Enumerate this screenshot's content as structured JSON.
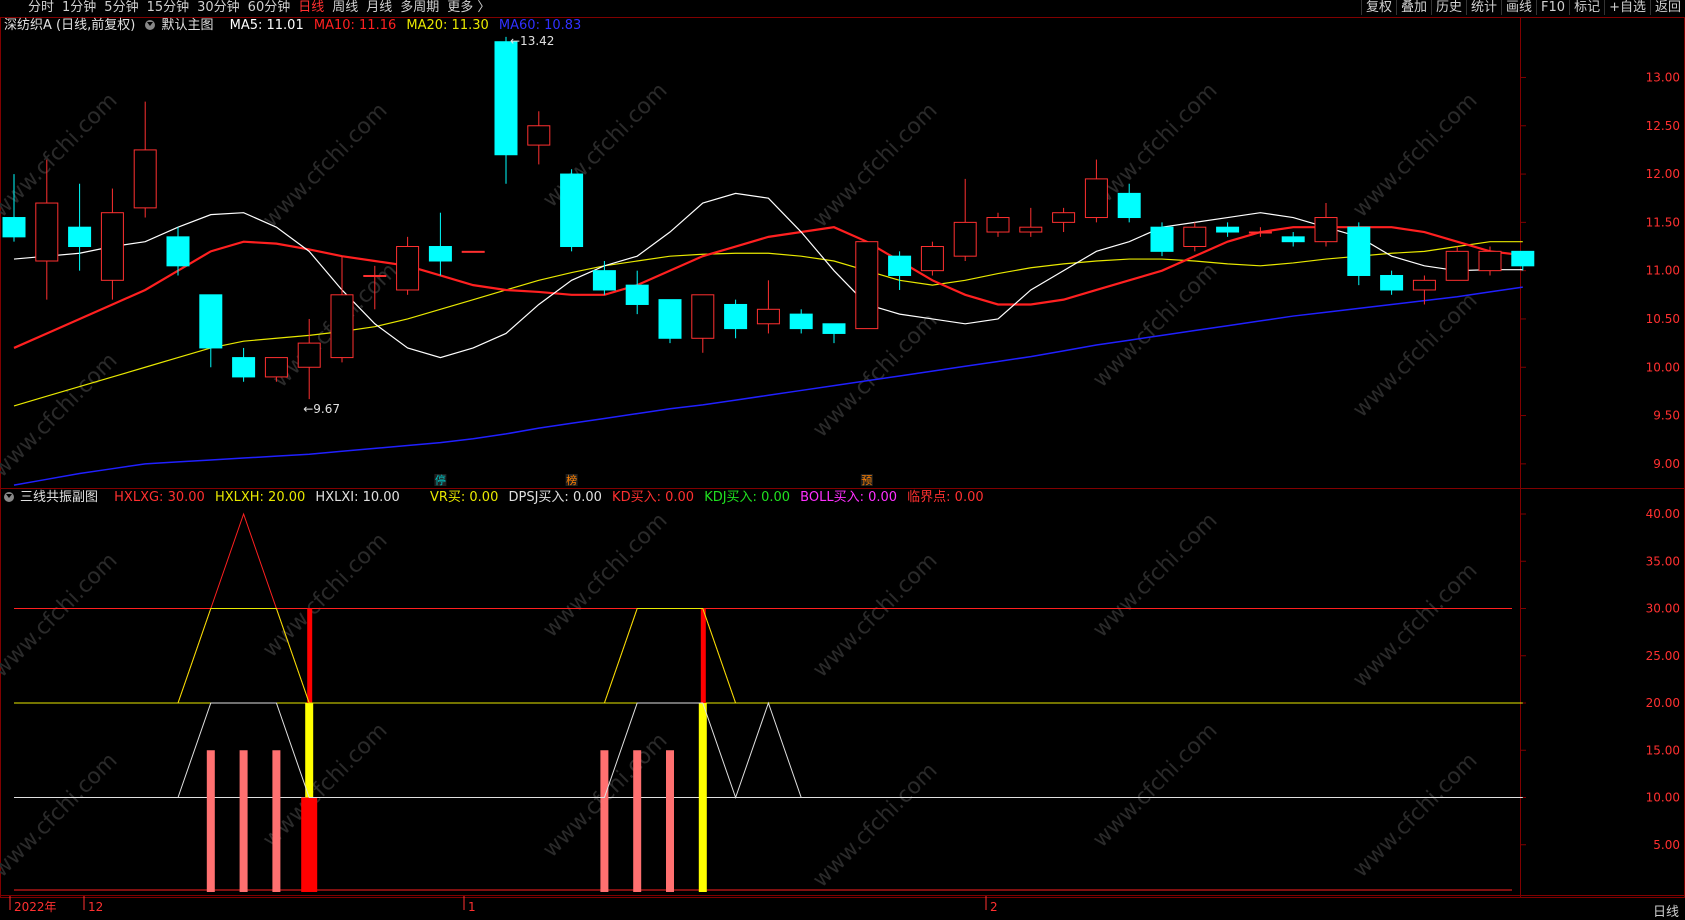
{
  "toolbar": {
    "periods": [
      "分时",
      "1分钟",
      "5分钟",
      "15分钟",
      "30分钟",
      "60分钟",
      "日线",
      "周线",
      "月线",
      "多周期",
      "更多 〉"
    ],
    "active_period": "日线",
    "right_buttons": [
      "复权",
      "叠加",
      "历史",
      "统计",
      "画线",
      "F10",
      "标记",
      "+自选",
      "返回"
    ]
  },
  "main_legend": {
    "stock": "深纺织A (日线,前复权)",
    "indicator": "默认主图",
    "ma5": "MA5: 11.01",
    "ma10": "MA10: 11.16",
    "ma20": "MA20: 11.30",
    "ma60": "MA60: 10.83"
  },
  "sub_legend": {
    "name": "三线共振副图",
    "hxlxg": "HXLXG: 30.00",
    "hxlxh": "HXLXH: 20.00",
    "hxlxi": "HXLXI: 10.00",
    "vr": "VR买: 0.00",
    "dpsj": "DPSJ买入: 0.00",
    "kd": "KD买入: 0.00",
    "kdj": "KDJ买入: 0.00",
    "boll": "BOLL买入: 0.00",
    "lj": "临界点: 0.00"
  },
  "colors": {
    "up": "#ff3030",
    "down": "#00ffff",
    "ma5": "#ffffff",
    "ma10": "#ff2020",
    "ma20": "#e8e800",
    "ma60": "#2020ff",
    "grid": "#800000",
    "axis_text": "#ff3030"
  },
  "markers": {
    "high": "13.42",
    "low": "9.67",
    "tags": [
      "停",
      "榜",
      "预"
    ]
  },
  "price_axis": [
    "13.00",
    "12.50",
    "12.00",
    "11.50",
    "11.00",
    "10.50",
    "10.00",
    "9.50",
    "9.00"
  ],
  "sub_axis": [
    "40.00",
    "35.00",
    "30.00",
    "25.00",
    "20.00",
    "15.00",
    "10.00",
    "5.00"
  ],
  "x_labels": [
    "2022年",
    "12",
    "1",
    "2"
  ],
  "bottom_right": "日线",
  "watermark": "www.cfchi.com",
  "chart_data": {
    "type": "candlestick",
    "price_range": [
      8.75,
      13.45
    ],
    "candles": [
      {
        "o": 11.55,
        "c": 11.35,
        "h": 12.0,
        "l": 11.3
      },
      {
        "o": 11.1,
        "c": 11.7,
        "h": 12.15,
        "l": 10.7
      },
      {
        "o": 11.45,
        "c": 11.25,
        "h": 11.9,
        "l": 11.0
      },
      {
        "o": 10.9,
        "c": 11.6,
        "h": 11.85,
        "l": 10.7
      },
      {
        "o": 11.65,
        "c": 12.25,
        "h": 12.75,
        "l": 11.55
      },
      {
        "o": 11.35,
        "c": 11.05,
        "h": 11.45,
        "l": 10.95
      },
      {
        "o": 10.75,
        "c": 10.2,
        "h": 10.65,
        "l": 10.0
      },
      {
        "o": 10.1,
        "c": 9.9,
        "h": 10.2,
        "l": 9.85
      },
      {
        "o": 9.9,
        "c": 10.1,
        "h": 10.1,
        "l": 9.85
      },
      {
        "o": 10.0,
        "c": 10.25,
        "h": 10.5,
        "l": 9.67
      },
      {
        "o": 10.1,
        "c": 10.75,
        "h": 11.15,
        "l": 10.05
      },
      {
        "o": 10.95,
        "c": 10.95,
        "h": 11.05,
        "l": 10.6
      },
      {
        "o": 10.8,
        "c": 11.25,
        "h": 11.35,
        "l": 10.75
      },
      {
        "o": 11.25,
        "c": 11.1,
        "h": 11.6,
        "l": 10.95
      },
      {
        "o": 11.2,
        "c": 11.2,
        "h": 11.2,
        "l": 11.2
      },
      {
        "o": 13.37,
        "c": 12.2,
        "h": 13.42,
        "l": 11.9
      },
      {
        "o": 12.3,
        "c": 12.5,
        "h": 12.65,
        "l": 12.1
      },
      {
        "o": 12.0,
        "c": 11.25,
        "h": 12.05,
        "l": 11.2
      },
      {
        "o": 11.0,
        "c": 10.8,
        "h": 11.1,
        "l": 10.75
      },
      {
        "o": 10.85,
        "c": 10.65,
        "h": 11.0,
        "l": 10.55
      },
      {
        "o": 10.7,
        "c": 10.3,
        "h": 10.7,
        "l": 10.25
      },
      {
        "o": 10.3,
        "c": 10.75,
        "h": 10.75,
        "l": 10.15
      },
      {
        "o": 10.65,
        "c": 10.4,
        "h": 10.7,
        "l": 10.3
      },
      {
        "o": 10.45,
        "c": 10.6,
        "h": 10.9,
        "l": 10.35
      },
      {
        "o": 10.55,
        "c": 10.4,
        "h": 10.6,
        "l": 10.35
      },
      {
        "o": 10.45,
        "c": 10.35,
        "h": 10.45,
        "l": 10.25
      },
      {
        "o": 10.4,
        "c": 11.3,
        "h": 11.3,
        "l": 10.4
      },
      {
        "o": 11.15,
        "c": 10.95,
        "h": 11.2,
        "l": 10.8
      },
      {
        "o": 11.0,
        "c": 11.25,
        "h": 11.3,
        "l": 10.95
      },
      {
        "o": 11.15,
        "c": 11.5,
        "h": 11.95,
        "l": 11.1
      },
      {
        "o": 11.4,
        "c": 11.55,
        "h": 11.6,
        "l": 11.35
      },
      {
        "o": 11.4,
        "c": 11.45,
        "h": 11.65,
        "l": 11.35
      },
      {
        "o": 11.5,
        "c": 11.6,
        "h": 11.65,
        "l": 11.4
      },
      {
        "o": 11.55,
        "c": 11.95,
        "h": 12.15,
        "l": 11.5
      },
      {
        "o": 11.8,
        "c": 11.55,
        "h": 11.9,
        "l": 11.5
      },
      {
        "o": 11.45,
        "c": 11.2,
        "h": 11.5,
        "l": 11.15
      },
      {
        "o": 11.25,
        "c": 11.45,
        "h": 11.5,
        "l": 11.2
      },
      {
        "o": 11.45,
        "c": 11.4,
        "h": 11.5,
        "l": 11.35
      },
      {
        "o": 11.4,
        "c": 11.4,
        "h": 11.45,
        "l": 11.35
      },
      {
        "o": 11.35,
        "c": 11.3,
        "h": 11.4,
        "l": 11.25
      },
      {
        "o": 11.3,
        "c": 11.55,
        "h": 11.7,
        "l": 11.25
      },
      {
        "o": 11.45,
        "c": 10.95,
        "h": 11.5,
        "l": 10.85
      },
      {
        "o": 10.95,
        "c": 10.8,
        "h": 11.0,
        "l": 10.75
      },
      {
        "o": 10.8,
        "c": 10.9,
        "h": 10.95,
        "l": 10.65
      },
      {
        "o": 10.9,
        "c": 11.2,
        "h": 11.25,
        "l": 10.9
      },
      {
        "o": 11.0,
        "c": 11.2,
        "h": 11.25,
        "l": 10.95
      },
      {
        "o": 11.2,
        "c": 11.05,
        "h": 11.2,
        "l": 11.0
      }
    ],
    "ma5": [
      11.12,
      11.15,
      11.18,
      11.25,
      11.3,
      11.45,
      11.58,
      11.6,
      11.45,
      11.2,
      10.8,
      10.45,
      10.2,
      10.1,
      10.2,
      10.35,
      10.65,
      10.9,
      11.05,
      11.15,
      11.4,
      11.7,
      11.8,
      11.75,
      11.4,
      11.0,
      10.65,
      10.55,
      10.5,
      10.45,
      10.5,
      10.8,
      11.0,
      11.2,
      11.3,
      11.45,
      11.5,
      11.55,
      11.6,
      11.55,
      11.45,
      11.35,
      11.15,
      11.05,
      11.0,
      11.01,
      11.01
    ],
    "ma10": [
      10.2,
      10.35,
      10.5,
      10.65,
      10.8,
      11.0,
      11.2,
      11.3,
      11.28,
      11.22,
      11.15,
      11.1,
      11.05,
      10.95,
      10.85,
      10.8,
      10.78,
      10.75,
      10.75,
      10.85,
      11.0,
      11.15,
      11.25,
      11.35,
      11.4,
      11.45,
      11.3,
      11.1,
      10.9,
      10.75,
      10.65,
      10.65,
      10.7,
      10.8,
      10.9,
      11.0,
      11.15,
      11.3,
      11.4,
      11.45,
      11.45,
      11.45,
      11.45,
      11.4,
      11.3,
      11.2,
      11.16
    ],
    "ma20": [
      9.6,
      9.7,
      9.8,
      9.9,
      10.0,
      10.1,
      10.2,
      10.27,
      10.3,
      10.33,
      10.37,
      10.42,
      10.5,
      10.6,
      10.7,
      10.8,
      10.9,
      10.98,
      11.05,
      11.1,
      11.15,
      11.17,
      11.18,
      11.18,
      11.15,
      11.1,
      11.0,
      10.9,
      10.85,
      10.9,
      10.97,
      11.03,
      11.07,
      11.1,
      11.12,
      11.12,
      11.1,
      11.07,
      11.05,
      11.08,
      11.12,
      11.15,
      11.18,
      11.2,
      11.25,
      11.3,
      11.3
    ],
    "ma60": [
      8.78,
      8.84,
      8.9,
      8.95,
      9.0,
      9.02,
      9.04,
      9.06,
      9.08,
      9.1,
      9.13,
      9.16,
      9.19,
      9.22,
      9.26,
      9.31,
      9.37,
      9.42,
      9.47,
      9.52,
      9.57,
      9.61,
      9.66,
      9.71,
      9.76,
      9.81,
      9.86,
      9.91,
      9.96,
      10.01,
      10.06,
      10.11,
      10.17,
      10.23,
      10.28,
      10.33,
      10.38,
      10.43,
      10.48,
      10.53,
      10.57,
      10.61,
      10.65,
      10.69,
      10.73,
      10.78,
      10.83
    ],
    "sub": {
      "range": [
        0,
        40
      ],
      "hxlxg": [
        30,
        30,
        30,
        30,
        30,
        30,
        30,
        30,
        30,
        30,
        30,
        30,
        30,
        30,
        30,
        30,
        30,
        30,
        30,
        30,
        30,
        30,
        30,
        30,
        30,
        30,
        30,
        30,
        30,
        30,
        30,
        30,
        30,
        30,
        30,
        30,
        30,
        30,
        30,
        30,
        30,
        30,
        30,
        30,
        30,
        30,
        30
      ],
      "hxlxh": [
        20,
        20,
        20,
        20,
        20,
        20,
        20,
        20,
        20,
        20,
        20,
        20,
        20,
        20,
        20,
        20,
        20,
        20,
        20,
        20,
        20,
        20,
        20,
        20,
        20,
        20,
        20,
        20,
        20,
        20,
        20,
        20,
        20,
        20,
        20,
        20,
        20,
        20,
        20,
        20,
        20,
        20,
        20,
        20,
        20,
        20,
        20
      ],
      "hxlxi": [
        10,
        10,
        10,
        10,
        10,
        10,
        10,
        10,
        10,
        10,
        10,
        10,
        10,
        10,
        10,
        10,
        10,
        10,
        10,
        10,
        10,
        10,
        10,
        10,
        10,
        10,
        10,
        10,
        10,
        10,
        10,
        10,
        10,
        10,
        10,
        10,
        10,
        10,
        10,
        10,
        10,
        10,
        10,
        10,
        10,
        10,
        10
      ],
      "yellow": [
        20,
        20,
        20,
        20,
        20,
        20,
        30,
        30,
        30,
        20,
        20,
        20,
        20,
        20,
        20,
        20,
        20,
        20,
        20,
        30,
        30,
        30,
        20,
        20,
        20,
        20,
        20,
        20,
        20,
        20,
        20,
        20,
        20,
        20,
        20,
        20,
        20,
        20,
        20,
        20,
        20,
        20,
        20,
        20,
        20,
        20,
        20
      ],
      "red": [
        20,
        20,
        20,
        20,
        20,
        20,
        30,
        40,
        30,
        20,
        20,
        20,
        20,
        20,
        20,
        20,
        20,
        20,
        20,
        30,
        30,
        30,
        20,
        20,
        20,
        20,
        20,
        20,
        20,
        20,
        20,
        20,
        20,
        20,
        20,
        20,
        20,
        20,
        20,
        20,
        20,
        20,
        20,
        20,
        20,
        20,
        20
      ],
      "white": [
        10,
        10,
        10,
        10,
        10,
        10,
        20,
        20,
        20,
        10,
        10,
        10,
        10,
        10,
        10,
        10,
        10,
        10,
        10,
        20,
        20,
        20,
        10,
        20,
        10,
        10,
        10,
        10,
        10,
        10,
        10,
        10,
        10,
        10,
        10,
        10,
        10,
        10,
        10,
        10,
        10,
        10,
        10,
        10,
        10,
        10,
        10
      ],
      "pink_bars": [
        6,
        7,
        8,
        18,
        19,
        20
      ],
      "yellow_bars": [
        9,
        21
      ],
      "red_bars": [
        9,
        21
      ],
      "big_red_bar": 9
    }
  }
}
